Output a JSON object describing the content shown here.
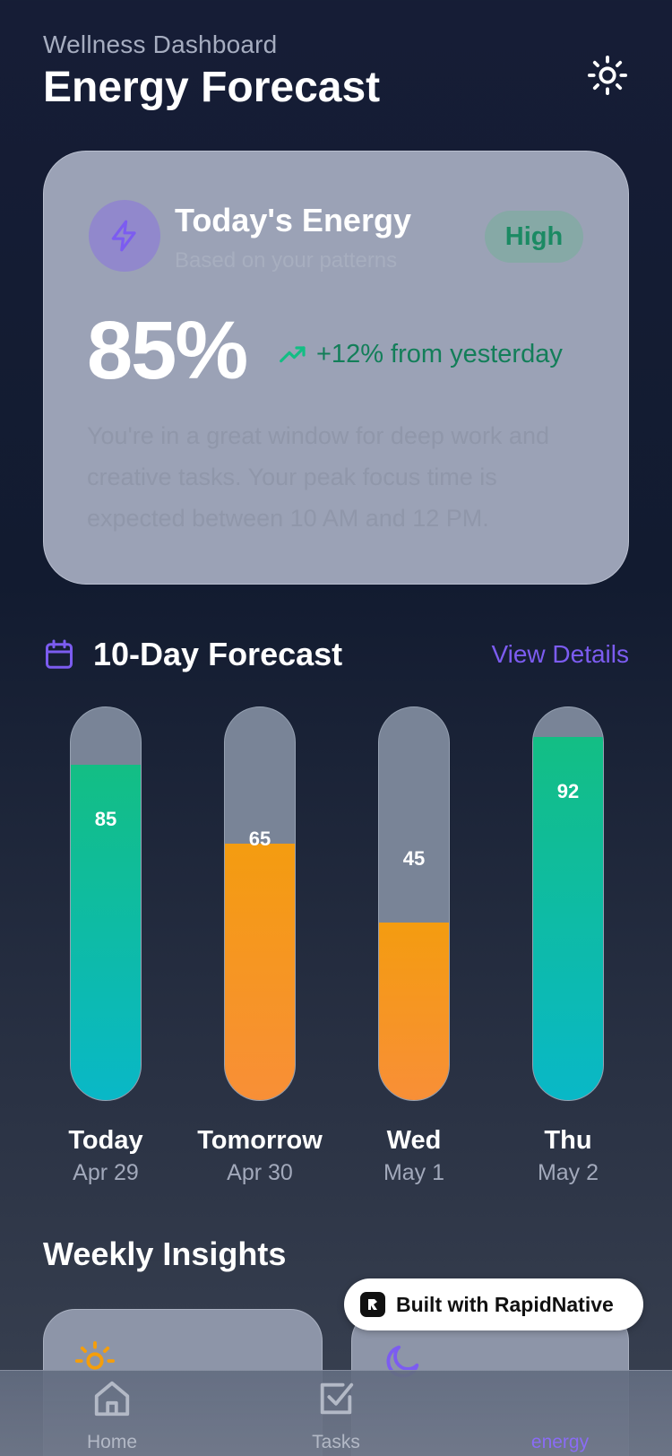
{
  "header": {
    "subtitle": "Wellness Dashboard",
    "title": "Energy Forecast",
    "theme_icon": "sun-icon"
  },
  "energy_card": {
    "icon": "lightning-bolt-icon",
    "title": "Today's Energy",
    "subtitle": "Based on your patterns",
    "level_badge": "High",
    "percent": "85%",
    "trend_icon": "trending-up-icon",
    "trend_text": "+12% from yesterday",
    "message": "You're in a great window for deep work and creative tasks. Your peak focus time is expected between 10 AM and 12 PM."
  },
  "forecast": {
    "icon": "calendar-icon",
    "title": "10-Day Forecast",
    "view_details": "View Details",
    "days": [
      {
        "label": "Today",
        "date": "Apr 29",
        "value": "85",
        "level": 0.85,
        "color": "green"
      },
      {
        "label": "Tomorrow",
        "date": "Apr 30",
        "value": "65",
        "level": 0.65,
        "color": "orange"
      },
      {
        "label": "Wed",
        "date": "May 1",
        "value": "45",
        "level": 0.45,
        "color": "orange"
      },
      {
        "label": "Thu",
        "date": "May 2",
        "value": "92",
        "level": 0.92,
        "color": "green"
      }
    ]
  },
  "insights": {
    "title": "Weekly Insights",
    "card_icons": [
      "sun-icon",
      "moon-icon"
    ]
  },
  "badge": {
    "text": "Built with RapidNative"
  },
  "tab_bar": {
    "tabs": [
      {
        "label": "Home",
        "icon": "home-icon"
      },
      {
        "label": "Tasks",
        "icon": "checkbox-icon"
      },
      {
        "label": "energy",
        "icon": "energy-icon",
        "active": true
      }
    ]
  },
  "colors": {
    "accent": "#7c5cf0",
    "green": "#13be84",
    "cyan": "#09b8c7",
    "orange": "#f49c10",
    "sun": "#f59e0b"
  }
}
